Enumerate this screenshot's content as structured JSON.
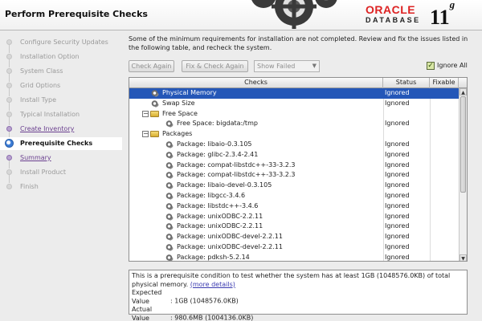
{
  "header": {
    "title": "Perform Prerequisite Checks",
    "logo_oracle": "ORACLE",
    "logo_database": "DATABASE",
    "logo_version": "11",
    "logo_version_suffix": "g"
  },
  "sidebar": {
    "steps": [
      {
        "label": "Configure Security Updates",
        "state": "disabled"
      },
      {
        "label": "Installation Option",
        "state": "disabled"
      },
      {
        "label": "System Class",
        "state": "disabled"
      },
      {
        "label": "Grid Options",
        "state": "disabled"
      },
      {
        "label": "Install Type",
        "state": "disabled"
      },
      {
        "label": "Typical Installation",
        "state": "disabled"
      },
      {
        "label": "Create Inventory",
        "state": "link"
      },
      {
        "label": "Prerequisite Checks",
        "state": "current"
      },
      {
        "label": "Summary",
        "state": "link"
      },
      {
        "label": "Install Product",
        "state": "disabled"
      },
      {
        "label": "Finish",
        "state": "disabled"
      }
    ]
  },
  "main": {
    "intro": "Some of the minimum requirements for installation are not completed. Review and fix the issues listed in the following table, and recheck the system.",
    "buttons": {
      "check_again": "Check Again",
      "fix_check_again": "Fix & Check Again"
    },
    "filter_select": {
      "value": "Show Failed"
    },
    "ignore_all": {
      "label": "Ignore All",
      "checked": true
    },
    "table": {
      "headers": {
        "checks": "Checks",
        "status": "Status",
        "fixable": "Fixable"
      },
      "rows": [
        {
          "label": "Physical Memory",
          "status": "Ignored",
          "level": 1,
          "icon": "gear-icon",
          "selected": true
        },
        {
          "label": "Swap Size",
          "status": "Ignored",
          "level": 1,
          "icon": "gear-icon"
        },
        {
          "label": "Free Space",
          "status": "",
          "level": 1,
          "icon": "folder-icon",
          "expandable": true
        },
        {
          "label": "Free Space: bigdata:/tmp",
          "status": "Ignored",
          "level": 2,
          "icon": "gear-icon"
        },
        {
          "label": "Packages",
          "status": "",
          "level": 1,
          "icon": "folder-icon",
          "expandable": true
        },
        {
          "label": "Package: libaio-0.3.105",
          "status": "Ignored",
          "level": 2,
          "icon": "gear-icon"
        },
        {
          "label": "Package: glibc-2.3.4-2.41",
          "status": "Ignored",
          "level": 2,
          "icon": "gear-icon"
        },
        {
          "label": "Package: compat-libstdc++-33-3.2.3",
          "status": "Ignored",
          "level": 2,
          "icon": "gear-icon"
        },
        {
          "label": "Package: compat-libstdc++-33-3.2.3",
          "status": "Ignored",
          "level": 2,
          "icon": "gear-icon"
        },
        {
          "label": "Package: libaio-devel-0.3.105",
          "status": "Ignored",
          "level": 2,
          "icon": "gear-icon"
        },
        {
          "label": "Package: libgcc-3.4.6",
          "status": "Ignored",
          "level": 2,
          "icon": "gear-icon"
        },
        {
          "label": "Package: libstdc++-3.4.6",
          "status": "Ignored",
          "level": 2,
          "icon": "gear-icon"
        },
        {
          "label": "Package: unixODBC-2.2.11",
          "status": "Ignored",
          "level": 2,
          "icon": "gear-icon"
        },
        {
          "label": "Package: unixODBC-2.2.11",
          "status": "Ignored",
          "level": 2,
          "icon": "gear-icon"
        },
        {
          "label": "Package: unixODBC-devel-2.2.11",
          "status": "Ignored",
          "level": 2,
          "icon": "gear-icon"
        },
        {
          "label": "Package: unixODBC-devel-2.2.11",
          "status": "Ignored",
          "level": 2,
          "icon": "gear-icon"
        },
        {
          "label": "Package: pdksh-5.2.14",
          "status": "Ignored",
          "level": 2,
          "icon": "gear-icon"
        }
      ]
    },
    "description": {
      "text": "This is a prerequisite condition to test whether the system has at least 1GB (1048576.0KB) of total physical memory.",
      "more_details": "(more details)",
      "expected_label": "Expected Value",
      "expected_value": ": 1GB (1048576.0KB)",
      "actual_label": "Actual Value",
      "actual_value": ": 980.6MB (1004136.0KB)"
    }
  },
  "colors": {
    "selection": "#2457b8",
    "oracle_red": "#d22222",
    "link": "#6a3f8f"
  }
}
